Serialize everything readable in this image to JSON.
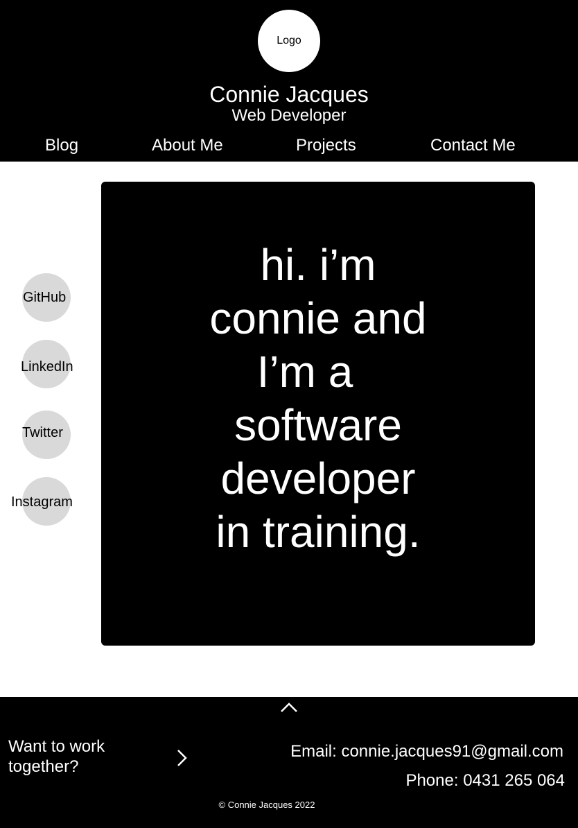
{
  "header": {
    "logo_label": "Logo",
    "name": "Connie Jacques",
    "role": "Web Developer",
    "nav": [
      "Blog",
      "About Me",
      "Projects",
      "Contact Me"
    ]
  },
  "social": [
    "GitHub",
    "LinkedIn",
    "Twitter",
    "Instagram"
  ],
  "hero": {
    "lines": [
      "hi. i’m",
      "connie and",
      "I’m a",
      "software",
      "developer",
      "in training."
    ]
  },
  "footer": {
    "cta": "Want to work together?",
    "email": "Email: connie.jacques91@gmail.com",
    "phone": "Phone: 0431 265 064",
    "copyright": "© Connie Jacques 2022",
    "icons": [
      "chevron-up-icon",
      "chevron-right-icon"
    ]
  },
  "colors": {
    "primary": "#000000",
    "background": "#ffffff",
    "social_circle": "#d9d9d9"
  }
}
